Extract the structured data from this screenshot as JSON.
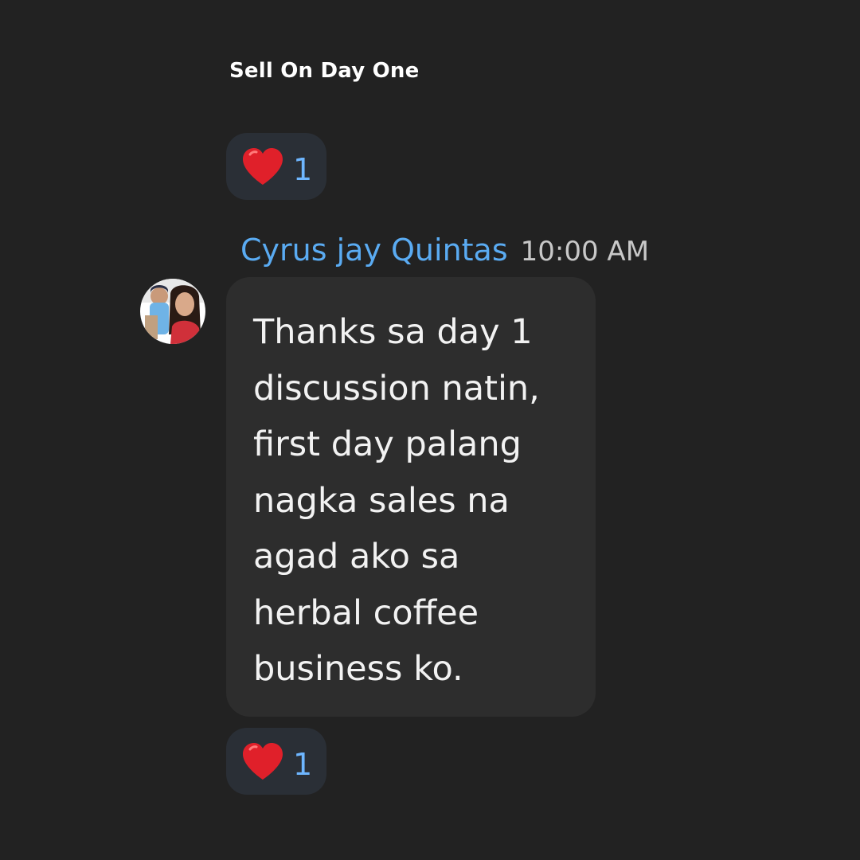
{
  "previous_message": {
    "title": "Sell On Day One",
    "reaction": {
      "icon": "heart-icon",
      "count": "1"
    }
  },
  "message": {
    "sender": "Cyrus jay Quintas",
    "time": "10:00 AM",
    "text": "Thanks sa day 1\ndiscussion natin,\nfirst day palang\nnagka sales na\nagad ako sa\nherbal coffee\nbusiness ko.",
    "reaction": {
      "icon": "heart-icon",
      "count": "1"
    }
  },
  "colors": {
    "background": "#222222",
    "bubble": "#2d2d2d",
    "sender_name": "#5aabf2",
    "reaction_count": "#6eb6ff",
    "reaction_pill": "#2a2f36",
    "heart": "#e0202a"
  }
}
